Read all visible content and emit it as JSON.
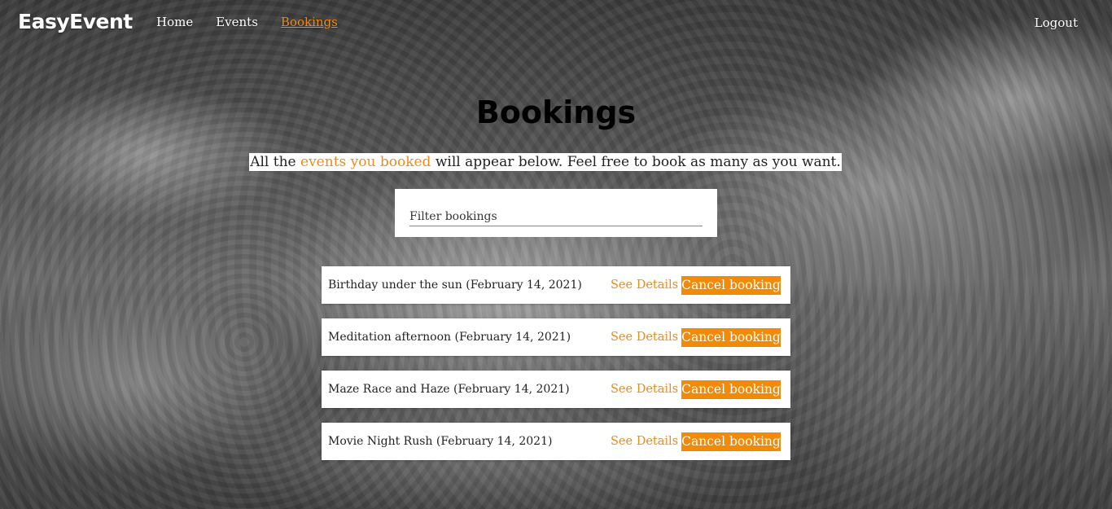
{
  "brand": "EasyEvent",
  "nav": {
    "links": [
      {
        "label": "Home",
        "active": false
      },
      {
        "label": "Events",
        "active": false
      },
      {
        "label": "Bookings",
        "active": true
      }
    ],
    "logout": "Logout"
  },
  "page": {
    "title": "Bookings",
    "subtitle_pre": "All the ",
    "subtitle_highlight": "events you booked",
    "subtitle_post": " will appear below. Feel free to book as many as you want."
  },
  "filter": {
    "placeholder": "Filter bookings",
    "value": ""
  },
  "bookings": [
    {
      "title": "Birthday under the sun (February 14, 2021)",
      "details_label": "See Details",
      "cancel_label": "Cancel booking"
    },
    {
      "title": "Meditation afternoon (February 14, 2021)",
      "details_label": "See Details",
      "cancel_label": "Cancel booking"
    },
    {
      "title": "Maze Race and Haze (February 14, 2021)",
      "details_label": "See Details",
      "cancel_label": "Cancel booking"
    },
    {
      "title": "Movie Night Rush (February 14, 2021)",
      "details_label": "See Details",
      "cancel_label": "Cancel booking"
    }
  ],
  "colors": {
    "accent": "#f08a18",
    "button": "#f08a08",
    "card": "#ffffff"
  }
}
